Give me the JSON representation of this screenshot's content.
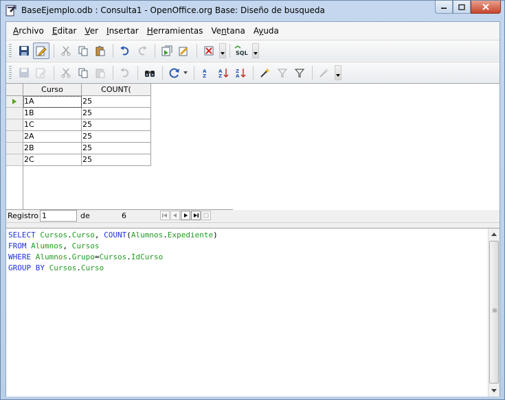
{
  "window": {
    "title": "BaseEjemplo.odb : Consulta1 - OpenOffice.org Base: Diseño de busqueda"
  },
  "menu": [
    {
      "label": "Archivo",
      "accel": "A",
      "rest": "rchivo"
    },
    {
      "label": "Editar",
      "accel": "E",
      "rest": "ditar"
    },
    {
      "label": "Ver",
      "accel": "V",
      "rest": "er"
    },
    {
      "label": "Insertar",
      "accel": "I",
      "rest": "nsertar"
    },
    {
      "label": "Herramientas",
      "accel": "H",
      "rest": "erramientas"
    },
    {
      "label": "Ventana",
      "accel": "n",
      "pre": "Ve",
      "rest": "tana"
    },
    {
      "label": "Ayuda",
      "accel": "y",
      "pre": "A",
      "rest": "uda"
    }
  ],
  "toolbar1": {
    "icons": [
      "save-icon",
      "edit-icon",
      "cut-icon",
      "copy-icon",
      "paste-icon",
      "undo-icon",
      "redo-icon",
      "run-query-icon",
      "clear-query-icon",
      "delete-icon",
      "sql-icon"
    ],
    "sql_label": "SQL"
  },
  "toolbar2": {
    "icons": [
      "save-record-icon",
      "edit-data-icon",
      "cut-icon",
      "copy-icon",
      "paste-icon",
      "undo-icon",
      "find-record-icon",
      "refresh-icon",
      "sort-ascending-icon",
      "sort-icon",
      "sort-descending-icon",
      "autofilter-icon",
      "standard-filter-icon",
      "filter-icon",
      "remove-filter-icon"
    ]
  },
  "grid": {
    "columns": [
      "Curso",
      "COUNT("
    ],
    "rows": [
      [
        "1A",
        "25"
      ],
      [
        "1B",
        "25"
      ],
      [
        "1C",
        "25"
      ],
      [
        "2A",
        "25"
      ],
      [
        "2B",
        "25"
      ],
      [
        "2C",
        "25"
      ]
    ]
  },
  "navigation": {
    "label": "Registro",
    "current": "1",
    "of_label": "de",
    "total": "6"
  },
  "sql": {
    "line1": {
      "kw1": "SELECT",
      "a": "Cursos",
      "b": "Curso",
      "kw2": "COUNT",
      "c": "Alumnos",
      "d": "Expediente"
    },
    "line2": {
      "kw": "FROM",
      "a": "Alumnos",
      "b": "Cursos"
    },
    "line3": {
      "kw": "WHERE",
      "a": "Alumnos",
      "b": "Grupo",
      "c": "Cursos",
      "d": "IdCurso"
    },
    "line4": {
      "kw": "GROUP BY",
      "a": "Cursos",
      "b": "Curso"
    }
  }
}
